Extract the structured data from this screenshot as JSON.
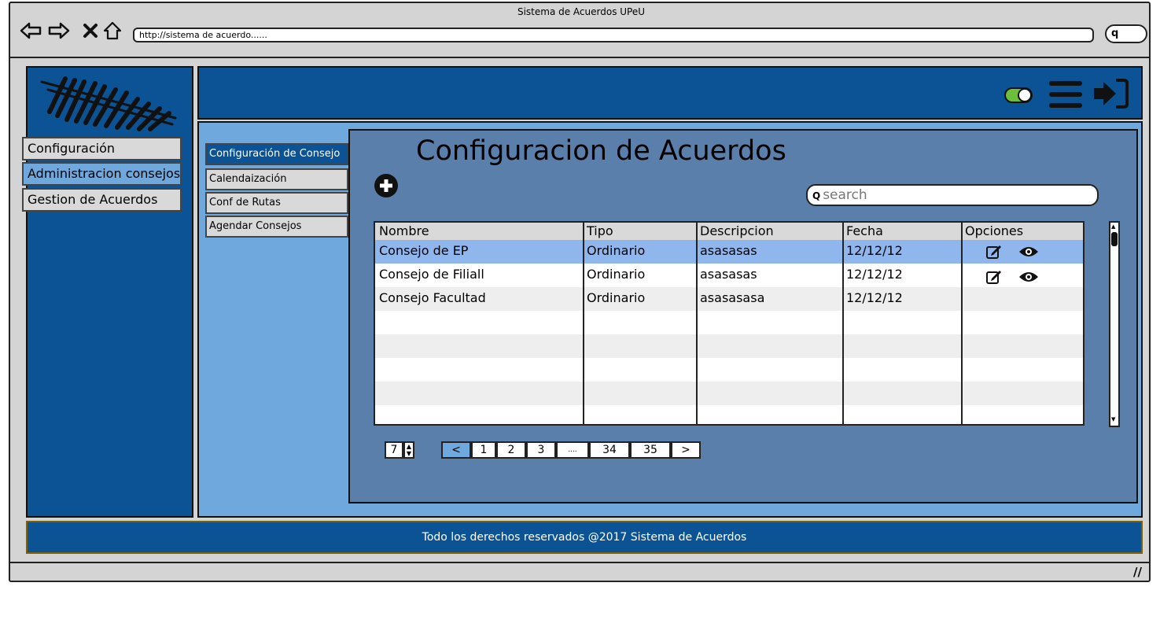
{
  "window": {
    "title": "Sistema de Acuerdos UPeU"
  },
  "browser": {
    "url": "http://sistema de acuerdo......",
    "search_glyph": "q",
    "nav_icons": [
      "back-arrow-icon",
      "forward-arrow-icon",
      "close-icon",
      "home-icon"
    ]
  },
  "sidebar": {
    "items": [
      {
        "label": "Configuración"
      },
      {
        "label": "Administracion consejos"
      },
      {
        "label": "Gestion de Acuerdos"
      }
    ]
  },
  "topbar": {
    "icons": [
      "toggle-icon",
      "hamburger-menu-icon",
      "logout-icon"
    ]
  },
  "submenu": {
    "items": [
      {
        "label": "Configuración de Consejo"
      },
      {
        "label": "Calendaización"
      },
      {
        "label": "Conf de Rutas"
      },
      {
        "label": "Agendar Consejos"
      }
    ]
  },
  "main": {
    "title": "Configuracion de Acuerdos",
    "search_placeholder": "search",
    "table": {
      "headers": [
        "Nombre",
        "Tipo",
        "Descripcion",
        "Fecha",
        "Opciones"
      ],
      "rows": [
        {
          "nombre": "Consejo de EP",
          "tipo": "Ordinario",
          "descripcion": "asasasas",
          "fecha": "12/12/12",
          "options": true,
          "selected": true
        },
        {
          "nombre": "Consejo de Filiall",
          "tipo": "Ordinario",
          "descripcion": "asasasas",
          "fecha": "12/12/12",
          "options": true
        },
        {
          "nombre": "Consejo Facultad",
          "tipo": "Ordinario",
          "descripcion": "asasasasa",
          "fecha": "12/12/12",
          "options": false
        }
      ]
    },
    "page_size": "7",
    "pagination": [
      "<",
      "1",
      "2",
      "3",
      "....",
      "34",
      "35",
      ">"
    ]
  },
  "footer": {
    "text": "Todo los derechos reservados @2017 Sistema de Acuerdos"
  },
  "colors": {
    "primary": "#0b5394",
    "accent": "#6fa8dc",
    "panel": "#5b7fab",
    "selected_row": "#8fb7ee"
  }
}
